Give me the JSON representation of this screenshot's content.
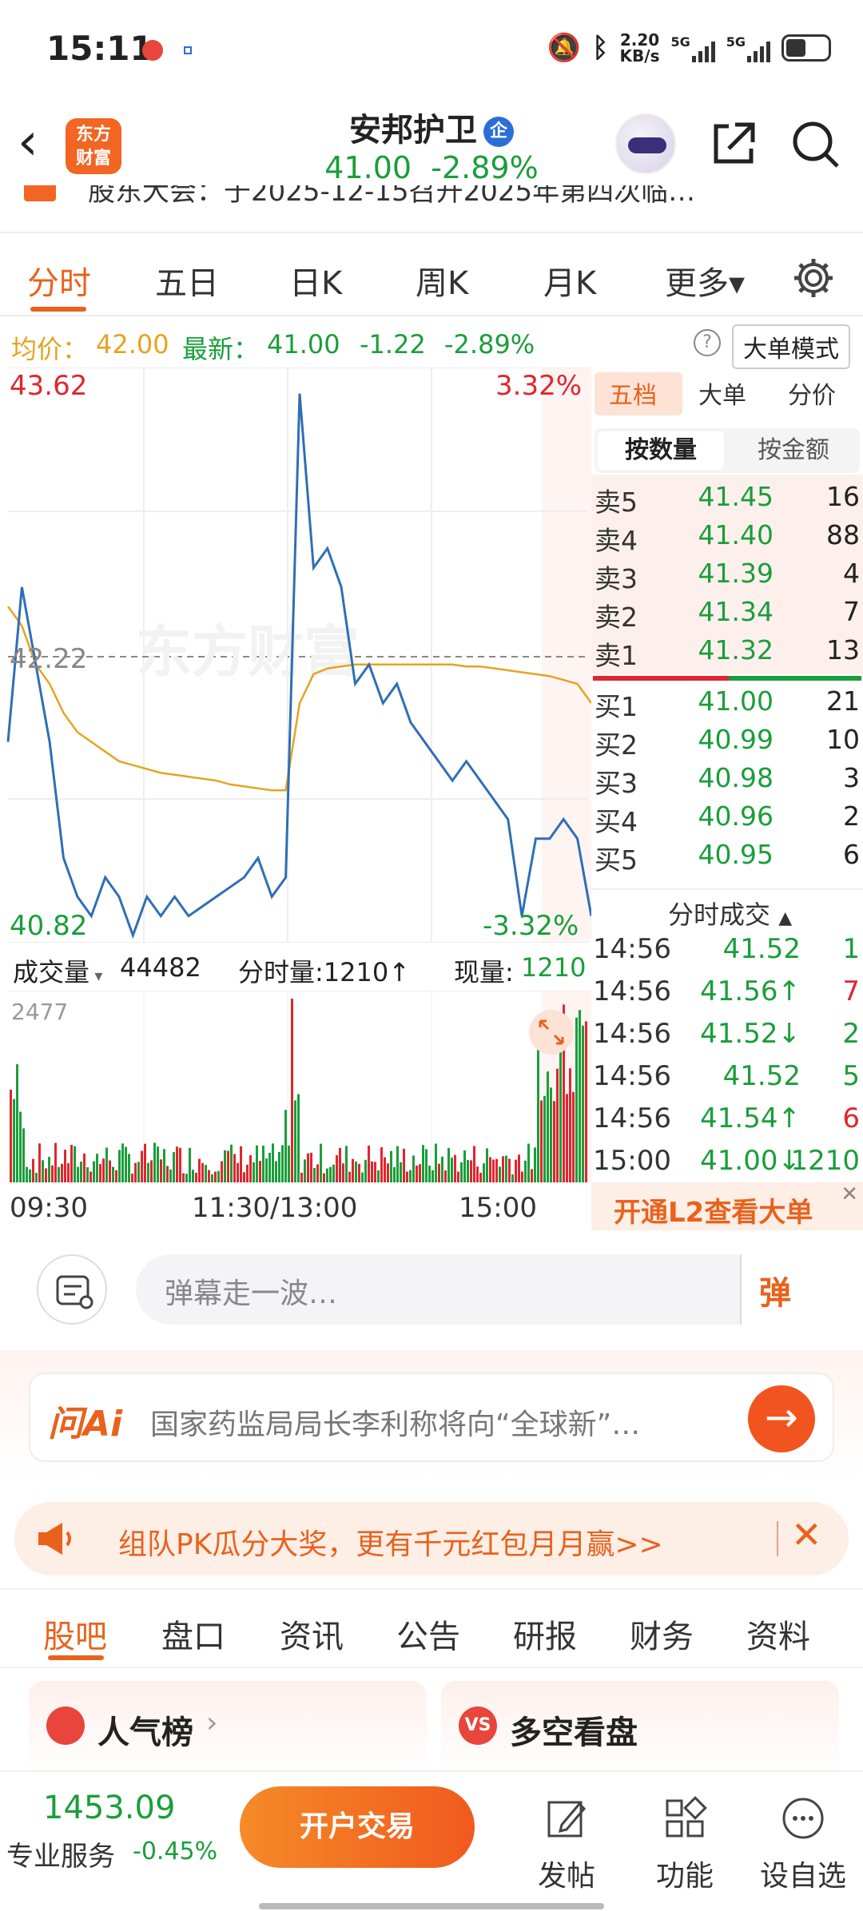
{
  "status": {
    "time": "15:11",
    "speed": "2.20",
    "speed_unit": "KB/s",
    "net1": "5G",
    "net2": "5G"
  },
  "header": {
    "logo_line1": "东方",
    "logo_line2": "财富",
    "name": "安邦护卫",
    "badge": "企",
    "price": "41.00",
    "change_pct": "-2.89%"
  },
  "notice": {
    "text": "股东大会：于2025-12-15召开2025年第四次临…"
  },
  "tabs": [
    "分时",
    "五日",
    "日K",
    "周K",
    "月K",
    "更多▾"
  ],
  "avg": {
    "avg_label": "均价：",
    "avg_value": "42.00",
    "latest_label": "最新：",
    "latest_value": "41.00",
    "change": "-1.22",
    "change_pct": "-2.89%",
    "mode_btn": "大单模式"
  },
  "chart": {
    "high": "43.62",
    "high_pct": "3.32%",
    "mid": "42.22",
    "low": "40.82",
    "low_pct": "-3.32%",
    "watermark": "东方财富",
    "vol_label": "成交量",
    "vol_total": "44482",
    "period_vol": "分时量:1210↑",
    "cur_vol_label": "现量:",
    "cur_vol": "1210",
    "vol_max": "2477",
    "time_start": "09:30",
    "time_mid": "11:30/13:00",
    "time_end": "15:00"
  },
  "chart_data": {
    "type": "line",
    "ylim": [
      40.82,
      43.62
    ],
    "reference": 42.22,
    "price": [
      41.8,
      42.6,
      42.2,
      41.8,
      41.2,
      41.0,
      40.9,
      41.1,
      41.0,
      40.8,
      41.0,
      40.9,
      41.0,
      40.9,
      40.95,
      41.0,
      41.05,
      41.1,
      41.2,
      41.0,
      41.1,
      43.6,
      42.7,
      42.8,
      42.6,
      42.1,
      42.2,
      42.0,
      42.1,
      41.9,
      41.8,
      41.7,
      41.6,
      41.7,
      41.6,
      41.5,
      41.4,
      40.9,
      41.3,
      41.3,
      41.4,
      41.3,
      40.9
    ],
    "avg_price": [
      42.5,
      42.4,
      42.2,
      42.1,
      41.95,
      41.85,
      41.8,
      41.75,
      41.7,
      41.68,
      41.66,
      41.64,
      41.63,
      41.62,
      41.61,
      41.6,
      41.58,
      41.57,
      41.56,
      41.55,
      41.55,
      42.0,
      42.15,
      42.18,
      42.19,
      42.2,
      42.2,
      42.2,
      42.2,
      42.2,
      42.2,
      42.2,
      42.2,
      42.19,
      42.19,
      42.18,
      42.17,
      42.16,
      42.15,
      42.14,
      42.12,
      42.1,
      42.0
    ]
  },
  "book": {
    "tab1": "五档",
    "tab2": "大单",
    "tab3": "分价",
    "btn1": "按数量",
    "btn2": "按金额",
    "asks": [
      {
        "l": "卖5",
        "p": "41.45",
        "q": "16"
      },
      {
        "l": "卖4",
        "p": "41.40",
        "q": "88"
      },
      {
        "l": "卖3",
        "p": "41.39",
        "q": "4"
      },
      {
        "l": "卖2",
        "p": "41.34",
        "q": "7"
      },
      {
        "l": "卖1",
        "p": "41.32",
        "q": "13"
      }
    ],
    "bids": [
      {
        "l": "买1",
        "p": "41.00",
        "q": "21"
      },
      {
        "l": "买2",
        "p": "40.99",
        "q": "10"
      },
      {
        "l": "买3",
        "p": "40.98",
        "q": "3"
      },
      {
        "l": "买4",
        "p": "40.96",
        "q": "2"
      },
      {
        "l": "买5",
        "p": "40.95",
        "q": "6"
      }
    ],
    "trades_title": "分时成交",
    "trades": [
      {
        "t": "14:56",
        "p": "41.52",
        "q": "1"
      },
      {
        "t": "14:56",
        "p": "41.56↑",
        "q": "7"
      },
      {
        "t": "14:56",
        "p": "41.52↓",
        "q": "2"
      },
      {
        "t": "14:56",
        "p": "41.52",
        "q": "5"
      },
      {
        "t": "14:56",
        "p": "41.54↑",
        "q": "6"
      },
      {
        "t": "15:00",
        "p": "41.00↓",
        "q": "1210"
      }
    ],
    "l2": "开通L2查看大单"
  },
  "danmu": {
    "placeholder": "弹幕走一波…",
    "btn": "弹"
  },
  "ai": {
    "logo": "问Ai",
    "text": "国家药监局局长李利称将向“全球新”…"
  },
  "promo": {
    "text": "组队PK瓜分大奖，更有千元红包月月赢>>"
  },
  "subtabs": [
    "股吧",
    "盘口",
    "资讯",
    "公告",
    "研报",
    "财务",
    "资料"
  ],
  "cards": {
    "c1": "人气榜",
    "c2": "多空看盘"
  },
  "bottom": {
    "index": "1453.09",
    "index_label": "专业服务",
    "index_pct": "-0.45%",
    "trade": "开户交易",
    "post": "发帖",
    "func": "功能",
    "fav": "设自选"
  },
  "colors": {
    "accent": "#e8621c",
    "up": "#e0262e",
    "down": "#1a9e3a",
    "avg": "#e3a520",
    "line": "#2e6fb5"
  }
}
